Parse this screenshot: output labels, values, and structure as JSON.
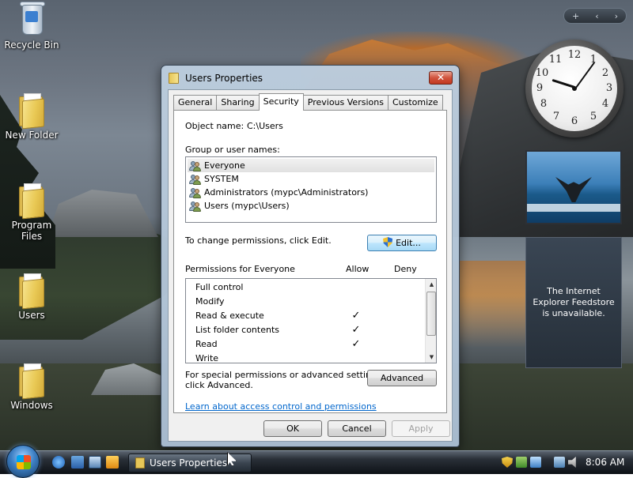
{
  "desktop": {
    "icons": [
      {
        "label": "Recycle Bin",
        "icon": "recycle-bin-icon"
      },
      {
        "label": "New Folder",
        "icon": "folder-icon"
      },
      {
        "label": "Program Files",
        "icon": "folder-icon"
      },
      {
        "label": "Users",
        "icon": "folder-icon"
      },
      {
        "label": "Windows",
        "icon": "folder-icon"
      }
    ]
  },
  "sidebar": {
    "controls": {
      "add": "+",
      "prev": "‹",
      "next": "›"
    },
    "clock_numbers": [
      "12",
      "1",
      "2",
      "3",
      "4",
      "5",
      "6",
      "7",
      "8",
      "9",
      "10",
      "11"
    ],
    "feed_message": "The Internet Explorer Feedstore is unavailable."
  },
  "window": {
    "title": "Users Properties",
    "close_label": "✕",
    "tabs": [
      "General",
      "Sharing",
      "Security",
      "Previous Versions",
      "Customize"
    ],
    "active_tab": "Security",
    "object_name_label": "Object name:",
    "object_name_value": "C:\\Users",
    "group_label": "Group or user names:",
    "groups": [
      "Everyone",
      "SYSTEM",
      "Administrators (mypc\\Administrators)",
      "Users (mypc\\Users)"
    ],
    "change_text": "To change permissions, click Edit.",
    "edit_label": "Edit...",
    "permissions_label": "Permissions for Everyone",
    "allow_header": "Allow",
    "deny_header": "Deny",
    "permissions": [
      {
        "name": "Full control",
        "allow": "",
        "deny": ""
      },
      {
        "name": "Modify",
        "allow": "",
        "deny": ""
      },
      {
        "name": "Read & execute",
        "allow": "✓",
        "deny": ""
      },
      {
        "name": "List folder contents",
        "allow": "✓",
        "deny": ""
      },
      {
        "name": "Read",
        "allow": "✓",
        "deny": ""
      },
      {
        "name": "Write",
        "allow": "",
        "deny": ""
      }
    ],
    "special_text_1": "For special permissions or advanced settings,",
    "special_text_2": "click Advanced.",
    "advanced_label": "Advanced",
    "learn_link": "Learn about access control and permissions",
    "ok_label": "OK",
    "cancel_label": "Cancel",
    "apply_label": "Apply"
  },
  "taskbar": {
    "active_task": "Users Properties",
    "time": "8:06 AM"
  }
}
